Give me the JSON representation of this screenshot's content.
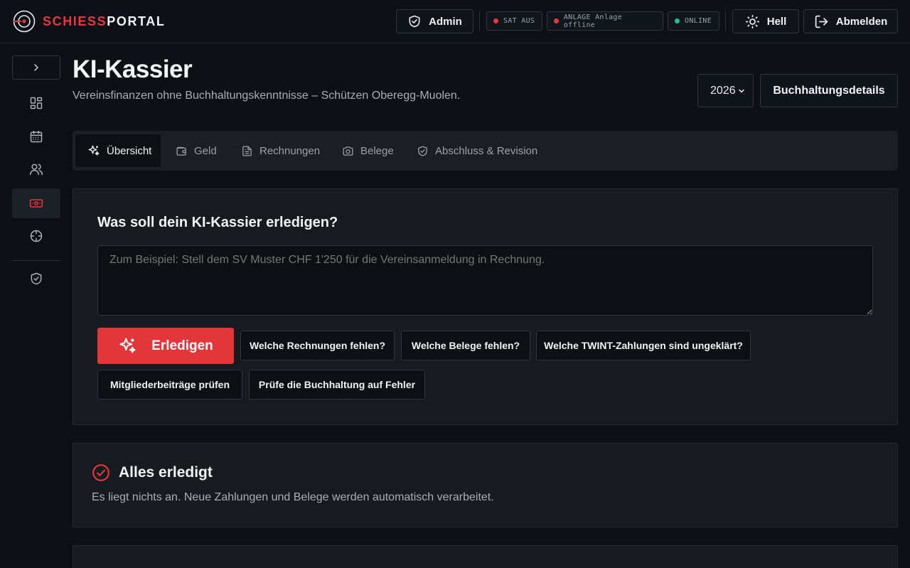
{
  "topbar": {
    "logo_part1": "SCHIESS",
    "logo_part2": "PORTAL",
    "admin_label": "Admin",
    "status_sat": "SAT AUS",
    "status_anlage": "ANLAGE Anlage offline",
    "status_online": "ONLINE",
    "theme_label": "Hell",
    "logout_label": "Abmelden"
  },
  "colors": {
    "accent": "#e3363b",
    "status_off": "#e8383d",
    "status_online": "#23c483"
  },
  "sidebar": {
    "icons": [
      "chevron-right-icon",
      "dashboard-grid-icon",
      "calendar-icon",
      "users-icon",
      "banknote-icon",
      "crosshair-icon",
      "shield-check-icon"
    ],
    "active": "banknote-icon"
  },
  "header": {
    "title": "KI-Kassier",
    "subtitle": "Vereinsfinanzen ohne Buchhaltungskenntnisse – Schützen Oberegg-Muolen.",
    "year": "2026",
    "details_label": "Buchhaltungsdetails"
  },
  "tabs": [
    {
      "label": "Übersicht",
      "icon": "sparkles-icon",
      "active": true
    },
    {
      "label": "Geld",
      "icon": "wallet-icon",
      "active": false
    },
    {
      "label": "Rechnungen",
      "icon": "document-icon",
      "active": false
    },
    {
      "label": "Belege",
      "icon": "camera-icon",
      "active": false
    },
    {
      "label": "Abschluss & Revision",
      "icon": "shield-check-icon",
      "active": false
    }
  ],
  "assistant": {
    "title": "Was soll dein KI-Kassier erledigen?",
    "placeholder": "Zum Beispiel: Stell dem SV Muster CHF 1'250 für die Vereinsanmeldung in Rechnung.",
    "submit_label": "Erledigen",
    "suggestions": [
      "Welche Rechnungen fehlen?",
      "Welche Belege fehlen?",
      "Welche TWINT-Zahlungen sind ungeklärt?",
      "Mitgliederbeiträge prüfen",
      "Prüfe die Buchhaltung auf Fehler"
    ]
  },
  "status_card": {
    "title": "Alles erledigt",
    "text": "Es liegt nichts an. Neue Zahlungen und Belege werden automatisch verarbeitet."
  }
}
